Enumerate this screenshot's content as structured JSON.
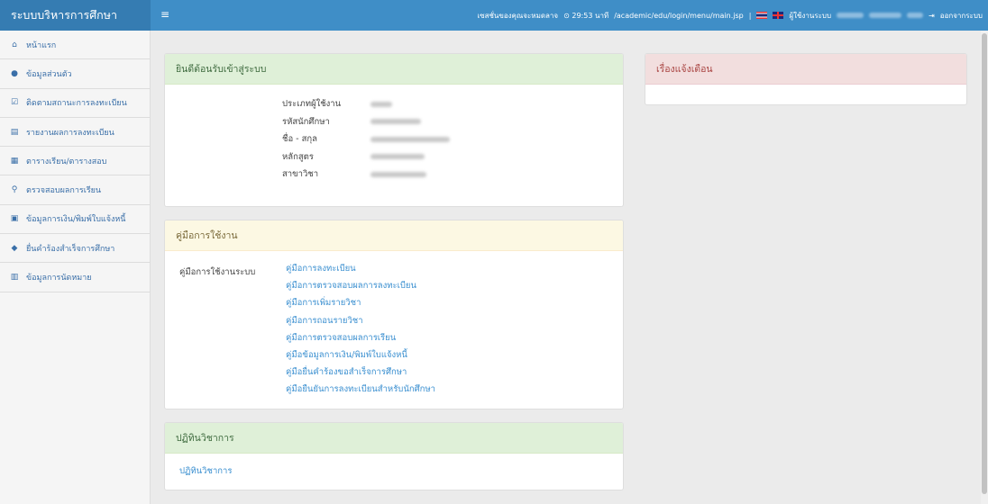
{
  "header": {
    "brand": "ระบบบริหารการศึกษา",
    "menu_icon": "hamburger-icon",
    "session_text": "เซสชั่นของคุณจะหมดลาจ",
    "timer": "⊙ 29:53 นาที",
    "path": "/academic/edu/login/menu/main.jsp",
    "separator": "|",
    "user_label": "ผู้ใช้งานระบบ",
    "logout_label": "ออกจากระบบ"
  },
  "sidebar": {
    "items": [
      {
        "label": "หน้าแรก",
        "icon": "home-icon"
      },
      {
        "label": "ข้อมูลส่วนตัว",
        "icon": "user-icon"
      },
      {
        "label": "ติดตามสถานะการลงทะเบียน",
        "icon": "check-square-icon"
      },
      {
        "label": "รายงานผลการลงทะเบียน",
        "icon": "document-icon"
      },
      {
        "label": "ตารางเรียน/ตารางสอบ",
        "icon": "table-icon"
      },
      {
        "label": "ตรวจสอบผลการเรียน",
        "icon": "search-icon"
      },
      {
        "label": "ข้อมูลการเงิน/พิมพ์ใบแจ้งหนี้",
        "icon": "money-icon"
      },
      {
        "label": "ยื่นคำร้องสำเร็จการศึกษา",
        "icon": "graduation-cap-icon"
      },
      {
        "label": "ข้อมูลการนัดหมาย",
        "icon": "calendar-icon"
      }
    ]
  },
  "welcome": {
    "title": "ยินดีต้อนรับเข้าสู่ระบบ",
    "rows": [
      {
        "label": "ประเภทผู้ใช้งาน"
      },
      {
        "label": "รหัสนักศึกษา"
      },
      {
        "label": "ชื่อ - สกุล"
      },
      {
        "label": "หลักสูตร"
      },
      {
        "label": "สาขาวิชา"
      }
    ]
  },
  "manual": {
    "title": "คู่มือการใช้งาน",
    "label": "คู่มือการใช้งานระบบ",
    "links": [
      "คู่มือการลงทะเบียน",
      "คู่มือการตรวจสอบผลการลงทะเบียน",
      "คู่มือการเพิ่มรายวิชา",
      "คู่มือการถอนรายวิชา",
      "คู่มือการตรวจสอบผลการเรียน",
      "คู่มือข้อมูลการเงิน/พิมพ์ใบแจ้งหนี้",
      "คู่มือยื่นคำร้องขอสำเร็จการศึกษา",
      "คู่มือยืนยันการลงทะเบียนสำหรับนักศึกษา"
    ]
  },
  "calendar": {
    "title": "ปฏิทินวิชาการ",
    "link": "ปฏิทินวิชาการ"
  },
  "alerts": {
    "title": "เรื่องแจ้งเตือน"
  },
  "colors": {
    "topbar": "#3f8ec7",
    "brand_bg": "#357cb2",
    "link": "#3a8fd0",
    "success_bg": "#dff0d8",
    "warning_bg": "#fcf8e3",
    "danger_bg": "#f2dede"
  }
}
